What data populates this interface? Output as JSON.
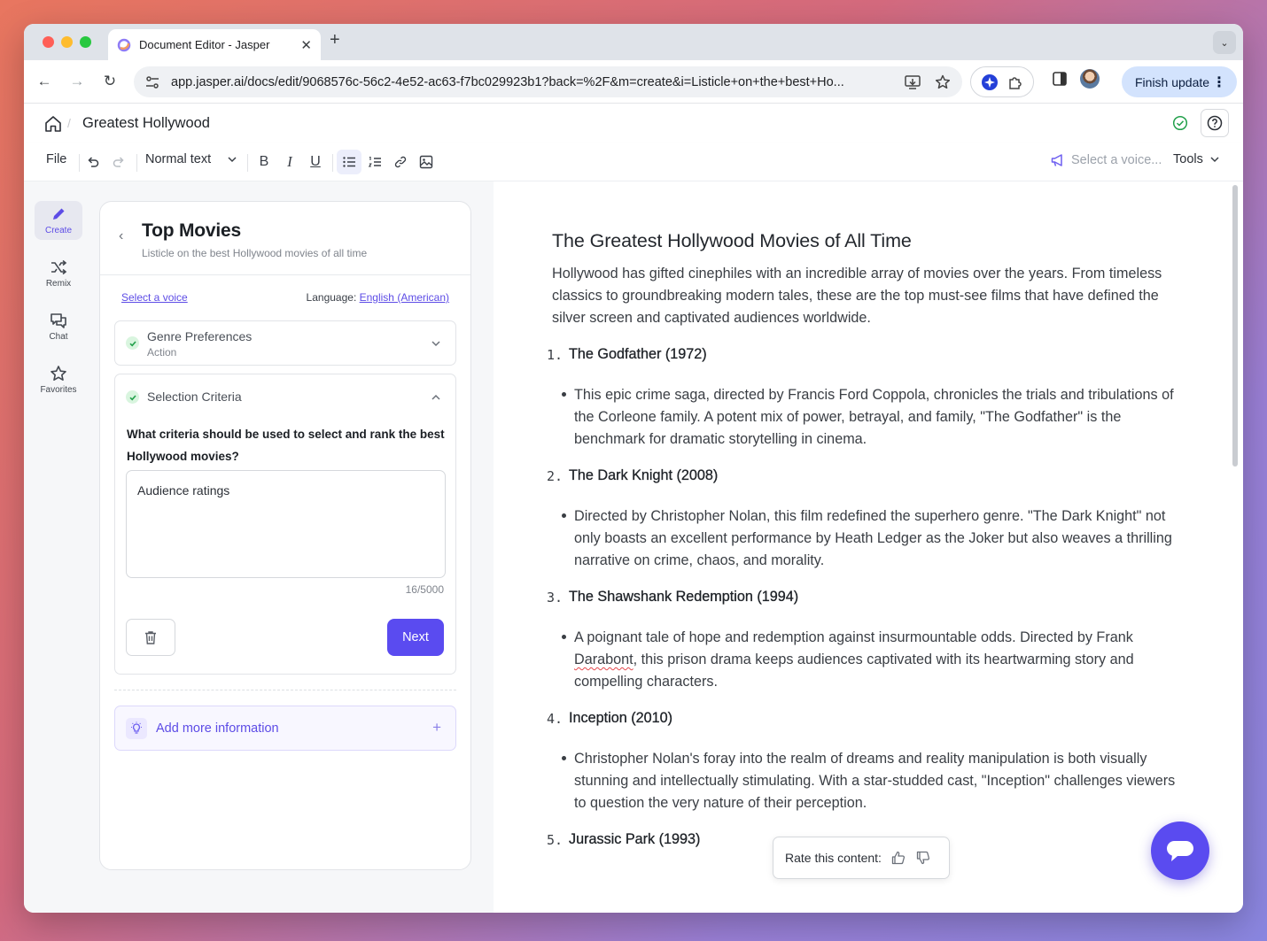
{
  "browser": {
    "tab_title": "Document Editor - Jasper",
    "url": "app.jasper.ai/docs/edit/9068576c-56c2-4e52-ac63-f7bc029923b1?back=%2F&m=create&i=Listicle+on+the+best+Ho...",
    "finish_update_label": "Finish update"
  },
  "header": {
    "doc_title": "Greatest Hollywood"
  },
  "editor_toolbar": {
    "file_label": "File",
    "text_style": "Normal text",
    "voice_placeholder": "Select a voice...",
    "tools_label": "Tools"
  },
  "rail": {
    "items": [
      {
        "label": "Create",
        "icon": "pencil-icon",
        "active": true
      },
      {
        "label": "Remix",
        "icon": "shuffle-icon"
      },
      {
        "label": "Chat",
        "icon": "chat-bubbles-icon"
      },
      {
        "label": "Favorites",
        "icon": "star-icon"
      }
    ]
  },
  "panel": {
    "title": "Top Movies",
    "subtitle": "Listicle on the best Hollywood movies of all time",
    "select_voice_link": "Select a voice",
    "language_label": "Language:",
    "language_value": "English (American)",
    "genre": {
      "title": "Genre Preferences",
      "value": "Action"
    },
    "criteria": {
      "title": "Selection Criteria",
      "question": "What criteria should be used to select and rank the best Hollywood movies?",
      "answer": "Audience ratings",
      "counter": "16/5000",
      "next_label": "Next"
    },
    "add_more_label": "Add more information"
  },
  "document": {
    "heading": "The Greatest Hollywood Movies of All Time",
    "intro": "Hollywood has gifted cinephiles with an incredible array of movies over the years. From timeless classics to groundbreaking modern tales, these are the top must-see films that have defined the silver screen and captivated audiences worldwide.",
    "items": [
      {
        "num": "1.",
        "title": "The Godfather (1972)",
        "desc": "This epic crime saga, directed by Francis Ford Coppola, chronicles the trials and tribulations of the Corleone family. A potent mix of power, betrayal, and family, \"The Godfather\" is the benchmark for dramatic storytelling in cinema."
      },
      {
        "num": "2.",
        "title": "The Dark Knight (2008)",
        "desc": "Directed by Christopher Nolan, this film redefined the superhero genre. \"The Dark Knight\" not only boasts an excellent performance by Heath Ledger as the Joker but also weaves a thrilling narrative on crime, chaos, and morality."
      },
      {
        "num": "3.",
        "title": "The Shawshank Redemption (1994)",
        "desc_pre": "A poignant tale of hope and redemption against insurmountable odds. Directed by Frank ",
        "desc_misspelled": "Darabont",
        "desc_post": ", this prison drama keeps audiences captivated with its heartwarming story and compelling characters."
      },
      {
        "num": "4.",
        "title": "Inception (2010)",
        "desc": "Christopher Nolan's foray into the realm of dreams and reality manipulation is both visually stunning and intellectually stimulating. With a star-studded cast, \"Inception\" challenges viewers to question the very nature of their perception."
      },
      {
        "num": "5.",
        "title": "Jurassic Park (1993)"
      }
    ],
    "rate_label": "Rate this content:"
  },
  "colors": {
    "accent": "#5a4bf0",
    "success": "#22a04b"
  }
}
